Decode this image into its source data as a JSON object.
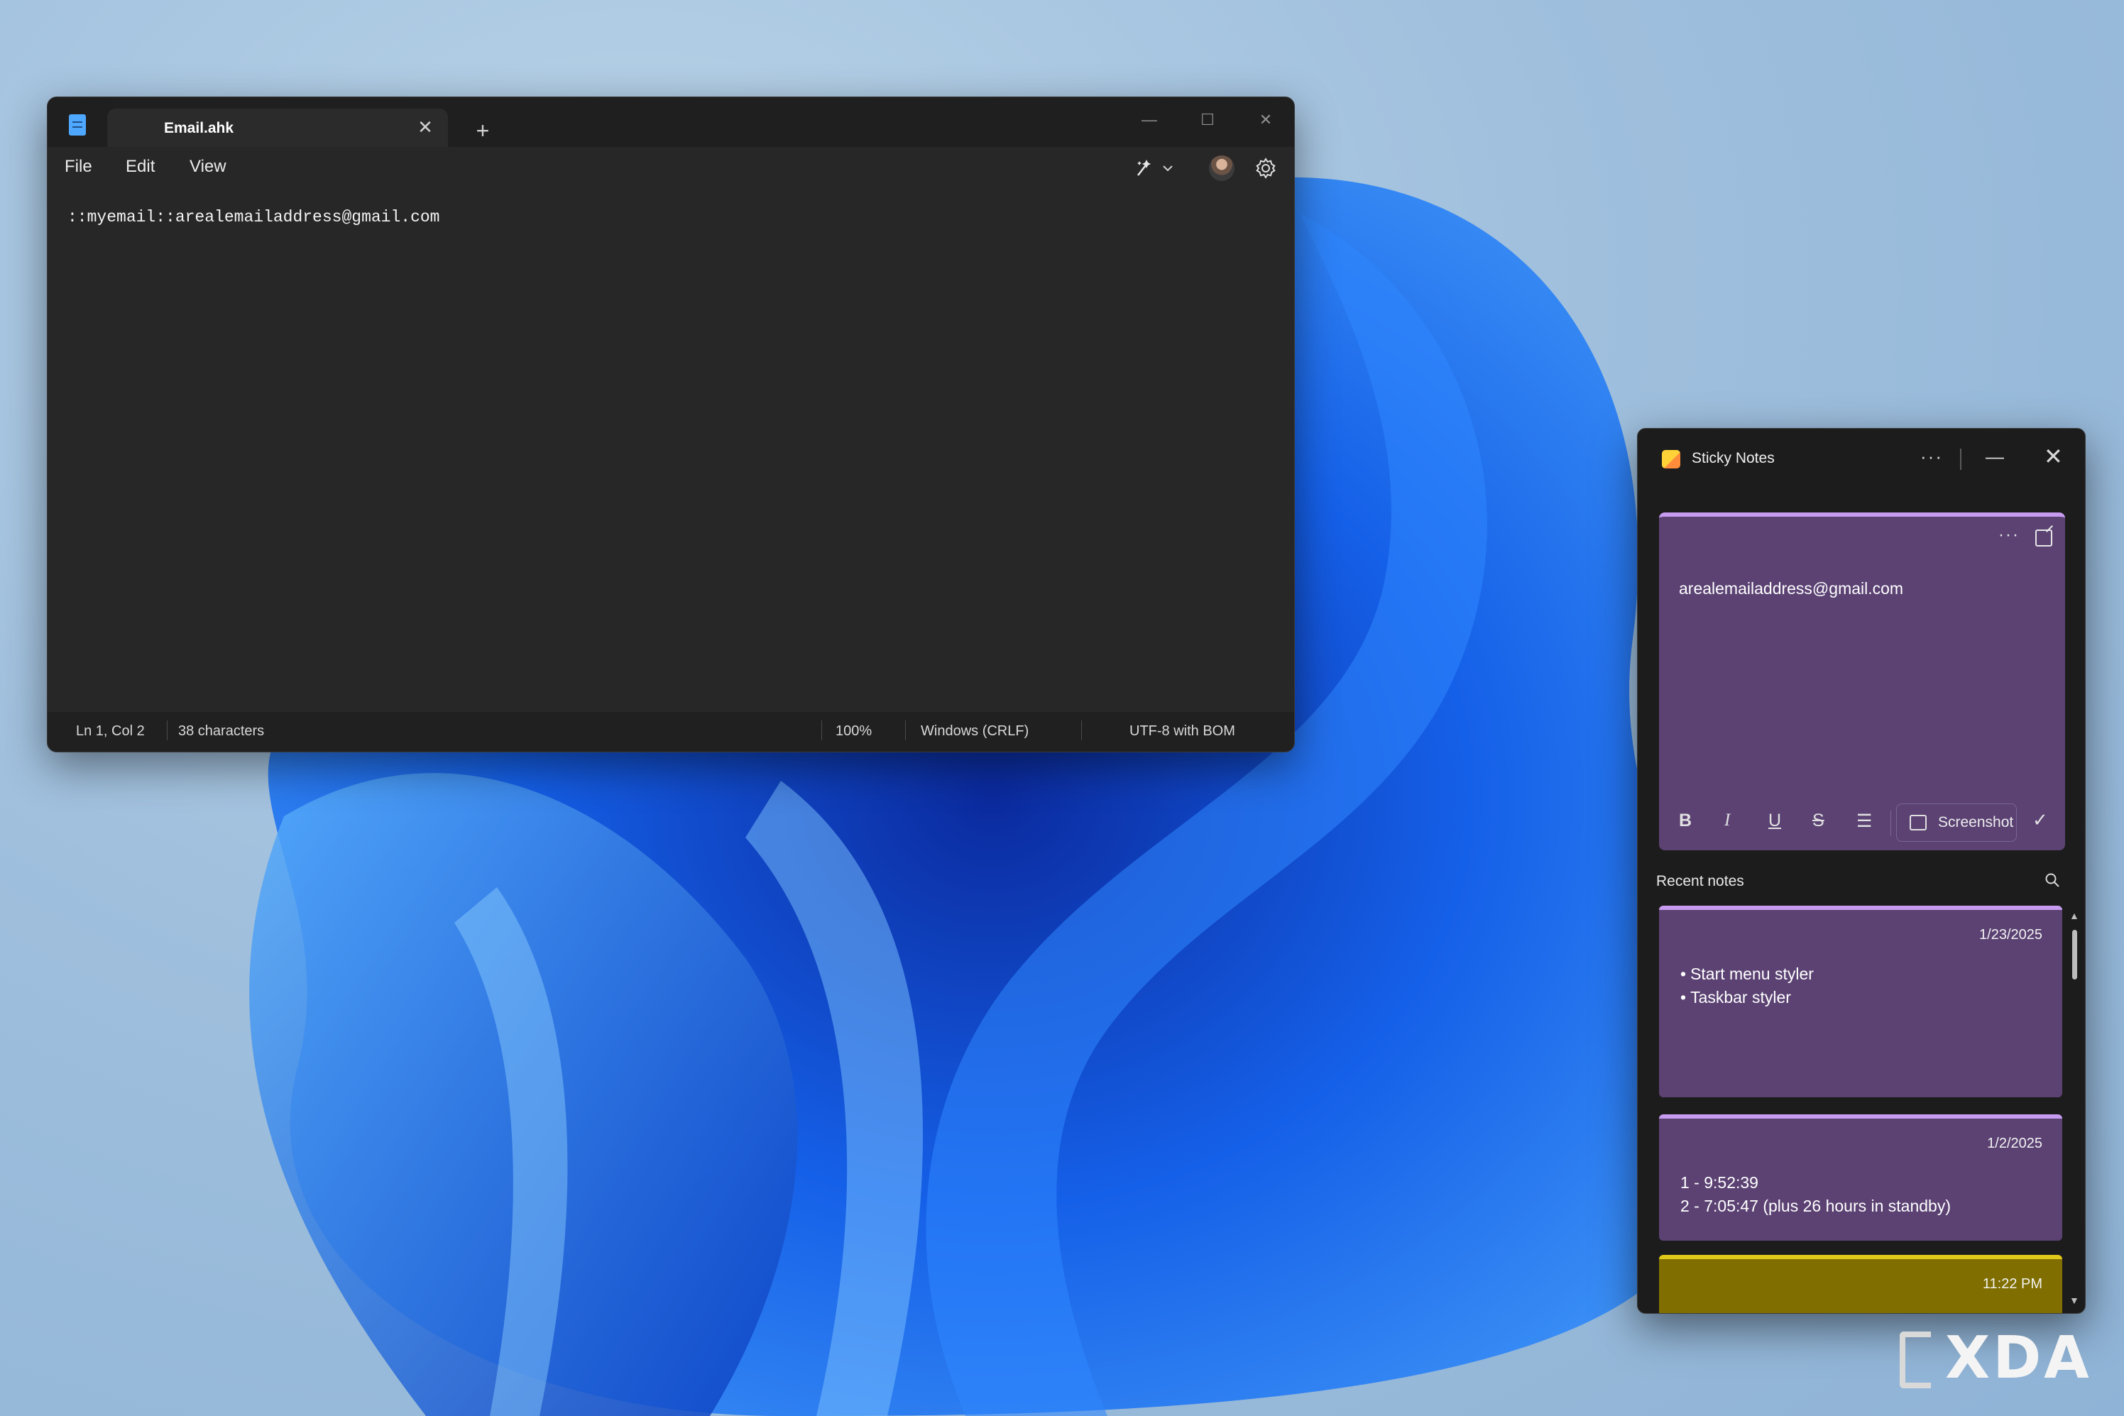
{
  "notepad": {
    "tab_title": "Email.ahk",
    "tab_close": "✕",
    "new_tab": "+",
    "window_controls": {
      "minimize": "—",
      "maximize": "☐",
      "close": "✕"
    },
    "menu": {
      "file": "File",
      "edit": "Edit",
      "view": "View"
    },
    "content": "::myemail::arealemailaddress@gmail.com",
    "status": {
      "position": "Ln 1, Col 2",
      "characters": "38 characters",
      "zoom": "100%",
      "line_ending": "Windows (CRLF)",
      "encoding": "UTF-8 with BOM"
    },
    "icons": {
      "app": "notepad-icon",
      "ai": "copilot-rewrite-icon",
      "avatar": "user-avatar",
      "settings": "gear-icon"
    }
  },
  "sticky_notes": {
    "title": "Sticky Notes",
    "more": "···",
    "minimize": "—",
    "close": "✕",
    "editor": {
      "more": "···",
      "text": "arealemailaddress@gmail.com",
      "toolbar": {
        "bold": "B",
        "italic": "I",
        "underline": "U",
        "strikethrough": "S",
        "list": "☰",
        "screenshot": "Screenshot",
        "done": "✓"
      }
    },
    "recent_label": "Recent notes",
    "notes": [
      {
        "date": "1/23/2025",
        "lines": [
          "Start menu styler",
          "Taskbar styler"
        ],
        "color": "#5b4273"
      },
      {
        "date": "1/2/2025",
        "lines": [
          "1 - 9:52:39",
          "2 - 7:05:47 (plus 26 hours in standby)"
        ],
        "color": "#5b4273"
      },
      {
        "date": "11:22 PM",
        "lines": [],
        "color": "#806f00"
      }
    ],
    "scroll": {
      "up": "▲",
      "down": "▼"
    }
  },
  "watermark": "XDA",
  "colors": {
    "note_purple": "#5b4273",
    "note_accent": "#c79bef",
    "note_yellow": "#806f00",
    "notepad_bg": "#272727"
  }
}
